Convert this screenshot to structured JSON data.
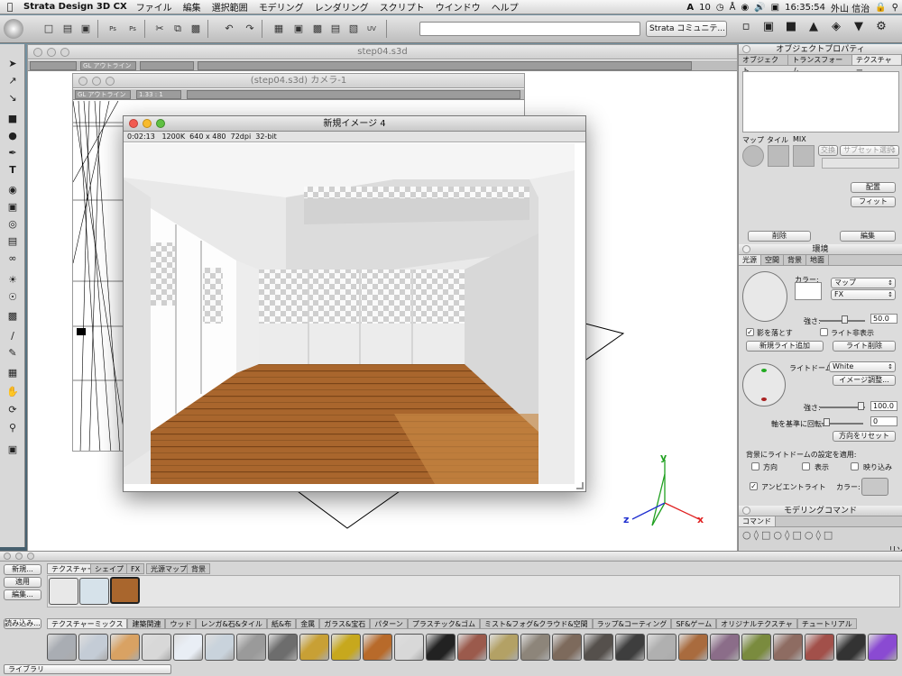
{
  "menubar": {
    "app": "Strata Design 3D CX",
    "items": [
      "ファイル",
      "編集",
      "選択範囲",
      "モデリング",
      "レンダリング",
      "スクリプト",
      "ウインドウ",
      "ヘルプ"
    ],
    "status": {
      "input": "A",
      "input_num": "10",
      "time": "16:35:54",
      "user": "外山 信治"
    }
  },
  "toolbar": {
    "community": "Strata コミュニテ..."
  },
  "main_window": {
    "title": "step04.s3d",
    "view_mode": "GL アウトライン"
  },
  "camera_window": {
    "title": "(step04.s3d) カメラ-1",
    "view_mode": "GL アウトライン",
    "zoom": "1.33 : 1"
  },
  "render_window": {
    "title": "新規イメージ 4",
    "info": "0:02:13   1200K  640 x 480  72dpi  32-bit"
  },
  "object_props": {
    "title": "オブジェクトプロパティ",
    "tabs": [
      "オブジェクト",
      "トランスフォーム",
      "テクスチャー"
    ],
    "map_labels": [
      "マップ",
      "タイル",
      "MIX"
    ],
    "exchange": "交換",
    "subset": "サブセット選択",
    "place": "配置",
    "fit": "フィット",
    "delete": "削除",
    "edit": "編集"
  },
  "environment": {
    "title": "環境",
    "tabs": [
      "光源",
      "空間",
      "背景",
      "地面"
    ],
    "color_label": "カラー:",
    "map_select": "マップ",
    "fx_select": "FX",
    "intensity_label": "強さ:",
    "intensity": "50.0",
    "cast_shadow": "影を落とす",
    "hide_light": "ライト非表示",
    "new_light": "新規ライト追加",
    "delete_light": "ライト削除",
    "dome_label": "ライトドーム:",
    "dome_value": "White",
    "image_adjust": "イメージ調整...",
    "dome_intensity": "100.0",
    "rotate_label": "軸を基準に回転:",
    "rotate_value": "0",
    "reset_dir": "方向をリセット",
    "apply_label": "背景にライトドームの設定を適用:",
    "apply_opts": [
      "方向",
      "表示",
      "映り込み"
    ],
    "ambient": "アンビエントライト",
    "ambient_color": "カラー:"
  },
  "modeling": {
    "title": "モデリングコマンド",
    "tab": "コマンド",
    "right_label": "リソ"
  },
  "library": {
    "top_tabs": [
      "テクスチャー",
      "シェイプ",
      "FX",
      "光源マップ",
      "背景"
    ],
    "side": {
      "new": "新規...",
      "apply": "適用",
      "edit": "編集...",
      "load": "読み込み..."
    },
    "categories": [
      "テクスチャーミックス",
      "建築関連",
      "ウッド",
      "レンガ&石&タイル",
      "紙&布",
      "金属",
      "ガラス&宝石",
      "パターン",
      "プラスチック&ゴム",
      "ミスト&フォグ&クラウド&空間",
      "ラップ&コーティング",
      "SF&ゲーム",
      "オリジナルテクスチャ",
      "チュートリアル"
    ],
    "footer": "ライブラリ",
    "swatch_colors": [
      "#a9adb3",
      "#c4ccd6",
      "#d9a263",
      "#d8d8d8",
      "#e9eef5",
      "#c9d3dc",
      "#9a9a9a",
      "#6d6d6d",
      "#c8a035",
      "#c7a81d",
      "#b86a2a",
      "#d8d8d8",
      "#222222",
      "#9b5a4c",
      "#b3a165",
      "#8d857a",
      "#7d6a5c",
      "#55504c",
      "#3e3e3e",
      "#b0b0b0",
      "#a96b3e",
      "#8b6d89",
      "#7a8b3e",
      "#8e6c62",
      "#a2504a",
      "#333333",
      "#8a4ad2"
    ]
  },
  "axis": {
    "x": "x",
    "y": "y",
    "z": "z"
  },
  "colors": {
    "x_axis": "#e02020",
    "y_axis": "#20a020",
    "z_axis": "#2030d0",
    "accent_purple": "#8a4ad2"
  }
}
